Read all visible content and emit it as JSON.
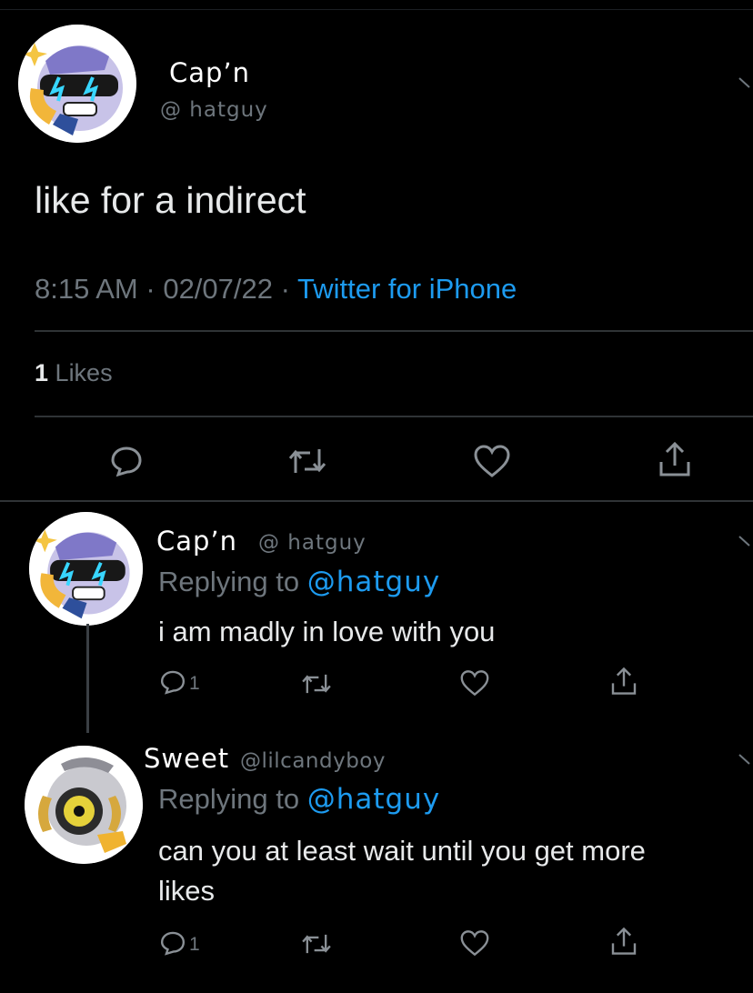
{
  "tweet": {
    "name": "Cap’n",
    "handle": "@ hatguy",
    "text": "like for a indirect",
    "time": "8:15 AM",
    "sep1": "·",
    "date": "02/07/22",
    "sep2": "·",
    "source": "Twitter for iPhone",
    "likes_count": "1",
    "likes_label": "Likes"
  },
  "replies": [
    {
      "name": "Cap’n",
      "handle": "@ hatguy",
      "replying_prefix": "Replying to",
      "replying_to": "@hatguy",
      "text": "i am madly in love with you",
      "reply_count": "1"
    },
    {
      "name": "Sweet",
      "handle": "@lilcandyboy",
      "replying_prefix": "Replying to",
      "replying_to": "@hatguy",
      "text_line1": "can you at least wait until you get more",
      "text_line2": "likes",
      "reply_count": "1"
    }
  ],
  "icons": [
    "reply-icon",
    "retweet-icon",
    "like-icon",
    "share-icon",
    "chevron-down-icon"
  ],
  "colors": {
    "background": "#000000",
    "text": "#e7e9ea",
    "muted": "#6e767d",
    "link": "#1d9bf0",
    "divider": "#2f3336"
  }
}
